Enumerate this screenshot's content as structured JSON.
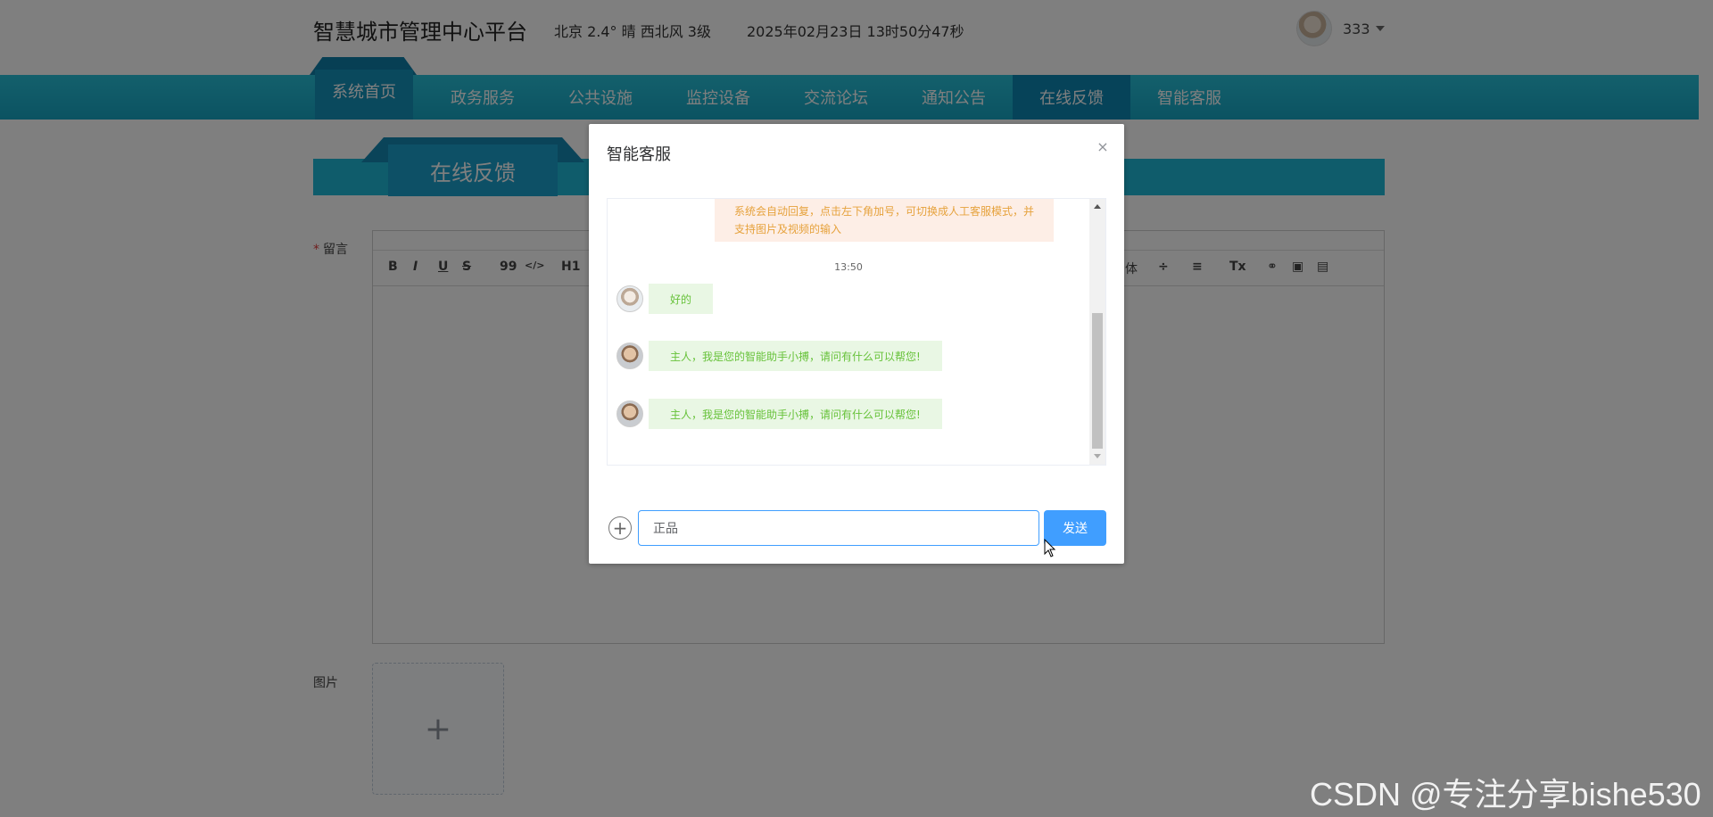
{
  "header": {
    "title": "智慧城市管理中心平台",
    "weather": "北京  2.4°  晴  西北风  3级",
    "datetime": "2025年02月23日 13时50分47秒",
    "user_name": "333"
  },
  "nav": {
    "items": [
      "系统首页",
      "政务服务",
      "公共设施",
      "监控设备",
      "交流论坛",
      "通知公告",
      "在线反馈",
      "智能客服"
    ],
    "active": "在线反馈"
  },
  "section": {
    "title": "在线反馈"
  },
  "form": {
    "message_label": "留言",
    "image_label": "图片",
    "toolbar": [
      "B",
      "I",
      "U",
      "S",
      "99",
      "</>",
      "H1",
      "体",
      "÷",
      "≡",
      "Tx",
      "⚭",
      "▣",
      "▤"
    ]
  },
  "dialog": {
    "title": "智能客服",
    "close": "×",
    "system_message": "系统会自动回复，点击左下角加号，可切换成人工客服模式，并支持图片及视频的输入",
    "time": "13:50",
    "messages": [
      {
        "from": "user",
        "text": "好的"
      },
      {
        "from": "bot",
        "text": "主人，我是您的智能助手小搏，请问有什么可以帮您!"
      },
      {
        "from": "bot",
        "text": "主人，我是您的智能助手小搏，请问有什么可以帮您!"
      }
    ],
    "input_value": "正品",
    "send_label": "发送"
  },
  "watermark": "CSDN @专注分享bishe530",
  "colors": {
    "nav": "#1fb8d6",
    "accent": "#409eff",
    "bubble": "#e9f7e4",
    "bubble_text": "#67c23a"
  }
}
